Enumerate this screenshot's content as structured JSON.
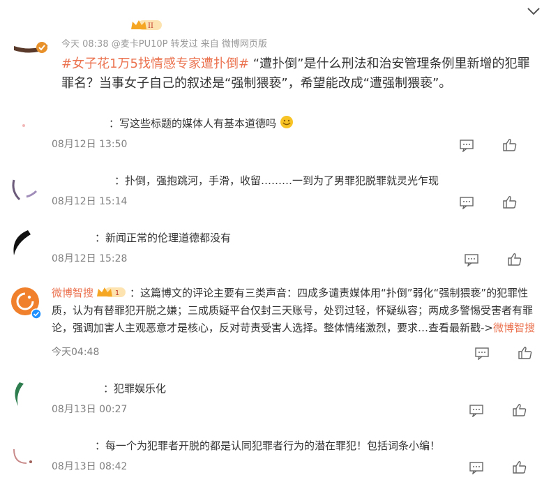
{
  "post": {
    "meta": "今天 08:38 @麦卡PU10P 转发过  来自 微博网页版",
    "hashtag": "#女子花1万5找情感专家遭扑倒#",
    "body": " “遭扑倒”是什么刑法和治安管理条例里新增的犯罪罪名？当事女子自己的叙述是“强制猥亵”，希望能改成“遭强制猥亵”。",
    "badge_level": "II"
  },
  "comments": [
    {
      "name": "",
      "text": "：写这些标题的媒体人有基本道德吗",
      "time": "08月12日 13:50"
    },
    {
      "name": "",
      "text": "：扑倒，强抱跳河，手滑，收留………一到为了男罪犯脱罪就灵光乍现",
      "time": "08月12日 15:14"
    },
    {
      "name": "",
      "text": "：新闻正常的伦理道德都没有",
      "time": "08月12日 15:28"
    },
    {
      "name": "微博智搜",
      "badge_level": "1",
      "text": "：这篇博文的评论主要有三类声音：四成多谴责媒体用“扑倒”弱化“强制猥亵”的犯罪性质，认为有替罪犯开脱之嫌；三成质疑平台仅封三天账号，处罚过轻，怀疑纵容；两成多警惕受害者有罪论，强调加害人主观恶意才是核心，反对苛责受害人选择。整体情绪激烈，要求…查看最新戳->",
      "more": "微博智搜",
      "time": "今天04:48"
    },
    {
      "name": "",
      "text": "：犯罪娱乐化",
      "time": "08月13日 00:27"
    },
    {
      "name": "",
      "text": "：每一个为犯罪者开脱的都是认同犯罪者行为的潜在罪犯！包括词条小编！",
      "time": "08月13日 08:42"
    }
  ],
  "icons": {
    "collapse": "chevron-down-icon",
    "reply": "comment-icon",
    "like": "thumbs-up-icon",
    "crown": "crown-badge-icon",
    "verified": "verified-icon",
    "emoji": "smile-emoji-icon"
  },
  "colors": {
    "hashtag": "#eb7350",
    "badge": "#f5a623",
    "verified": "#1e90ff",
    "zhisou": "#f0802b"
  }
}
